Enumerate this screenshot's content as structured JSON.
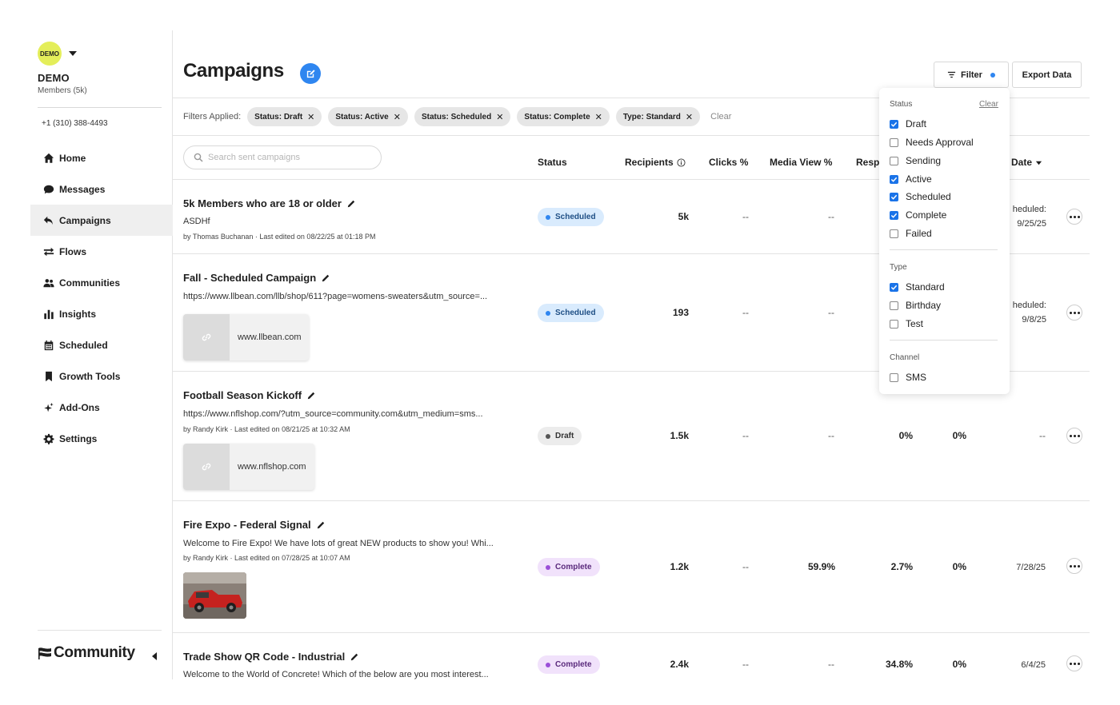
{
  "org": {
    "avatar_text": "DEMO",
    "name": "DEMO",
    "members": "Members (5k)",
    "phone": "+1 (310) 388-4493"
  },
  "nav": [
    {
      "label": "Home",
      "icon": "home-icon"
    },
    {
      "label": "Messages",
      "icon": "message-icon"
    },
    {
      "label": "Campaigns",
      "icon": "campaigns-icon",
      "active": true
    },
    {
      "label": "Flows",
      "icon": "flows-icon"
    },
    {
      "label": "Communities",
      "icon": "communities-icon"
    },
    {
      "label": "Insights",
      "icon": "bar-chart-icon"
    },
    {
      "label": "Scheduled",
      "icon": "calendar-icon"
    },
    {
      "label": "Growth Tools",
      "icon": "bookmark-icon"
    },
    {
      "label": "Add-Ons",
      "icon": "sparkle-icon"
    },
    {
      "label": "Settings",
      "icon": "gear-icon"
    }
  ],
  "brand": "Community",
  "header": {
    "title": "Campaigns",
    "filter_label": "Filter",
    "export_label": "Export Data"
  },
  "filters": {
    "label": "Filters Applied:",
    "chips": [
      "Status: Draft",
      "Status: Active",
      "Status: Scheduled",
      "Status: Complete",
      "Type: Standard"
    ],
    "clear_label": "Clear"
  },
  "search": {
    "placeholder": "Search sent campaigns"
  },
  "columns": {
    "status": "Status",
    "recipients": "Recipients",
    "clicks": "Clicks %",
    "media_view": "Media View %",
    "resp": "Resp",
    "date": "Date"
  },
  "rows": [
    {
      "title": "5k Members who are 18 or older",
      "desc": "ASDHf",
      "meta": "by Thomas Buchanan · Last edited on 08/22/25 at 01:18 PM",
      "status": "Scheduled",
      "recipients": "5k",
      "clicks": "--",
      "media_view": "--",
      "date_line1": "heduled:",
      "date_line2": "9/25/25"
    },
    {
      "title": "Fall - Scheduled Campaign",
      "desc": "https://www.llbean.com/llb/shop/611?page=womens-sweaters&utm_source=...",
      "link_card": "www.llbean.com",
      "status": "Scheduled",
      "recipients": "193",
      "clicks": "--",
      "media_view": "--",
      "date_line1": "heduled:",
      "date_line2": "9/8/25"
    },
    {
      "title": "Football Season Kickoff",
      "desc": "https://www.nflshop.com/?utm_source=community.com&utm_medium=sms...",
      "meta": "by Randy Kirk · Last edited on 08/21/25 at 10:32 AM",
      "link_card": "www.nflshop.com",
      "status": "Draft",
      "recipients": "1.5k",
      "clicks": "--",
      "media_view": "--",
      "resp": "0%",
      "extra": "0%",
      "date": "--"
    },
    {
      "title": "Fire Expo - Federal Signal",
      "desc": "Welcome to Fire Expo! We have lots of great NEW products to show you! Whi...",
      "meta": "by Randy Kirk · Last edited on 07/28/25 at 10:07 AM",
      "status": "Complete",
      "recipients": "1.2k",
      "clicks": "--",
      "media_view": "59.9%",
      "resp": "2.7%",
      "extra": "0%",
      "date": "7/28/25"
    },
    {
      "title": "Trade Show QR Code - Industrial",
      "desc": "Welcome to the World of Concrete! Which of the below are you most interest...",
      "status": "Complete",
      "recipients": "2.4k",
      "clicks": "--",
      "media_view": "--",
      "resp": "34.8%",
      "extra": "0%",
      "date": "6/4/25"
    }
  ],
  "dropdown": {
    "status_heading": "Status",
    "clear_label": "Clear",
    "status_options": [
      {
        "label": "Draft",
        "checked": true
      },
      {
        "label": "Needs Approval",
        "checked": false
      },
      {
        "label": "Sending",
        "checked": false
      },
      {
        "label": "Active",
        "checked": true
      },
      {
        "label": "Scheduled",
        "checked": true
      },
      {
        "label": "Complete",
        "checked": true
      },
      {
        "label": "Failed",
        "checked": false
      }
    ],
    "type_heading": "Type",
    "type_options": [
      {
        "label": "Standard",
        "checked": true
      },
      {
        "label": "Birthday",
        "checked": false
      },
      {
        "label": "Test",
        "checked": false
      }
    ],
    "channel_heading": "Channel",
    "channel_options": [
      {
        "label": "SMS",
        "checked": false
      }
    ]
  },
  "colors": {
    "accent": "#2f86f0",
    "avatar": "#e4ee5a",
    "scheduled_bg": "#d9ebfd",
    "complete_bg": "#f1e2fb",
    "draft_bg": "#ececec"
  }
}
